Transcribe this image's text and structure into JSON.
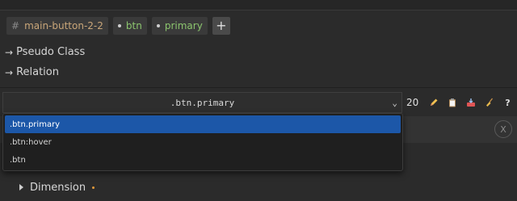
{
  "selector_chips": {
    "id_symbol": "#",
    "id_name": "main-button-2-2",
    "classes": [
      "btn",
      "primary"
    ],
    "add_label": "+"
  },
  "sections": {
    "pseudo_class": "Pseudo Class",
    "relation": "Relation",
    "arrow": "→"
  },
  "state_select": {
    "value": ".btn.primary",
    "options": [
      ".btn.primary",
      ".btn:hover",
      ".btn"
    ]
  },
  "toolbar": {
    "count": "20",
    "icons": [
      "pencil-icon",
      "clipboard-icon",
      "inbox-tray-icon",
      "broom-icon"
    ],
    "help": "?"
  },
  "subpanel": {
    "close": "X"
  },
  "dimension": {
    "label": "Dimension",
    "modified_dot_color": "#e39a3b"
  },
  "colors": {
    "selected": "#1c57a8",
    "id_text": "#c9a679",
    "class_text": "#8cc56e"
  }
}
